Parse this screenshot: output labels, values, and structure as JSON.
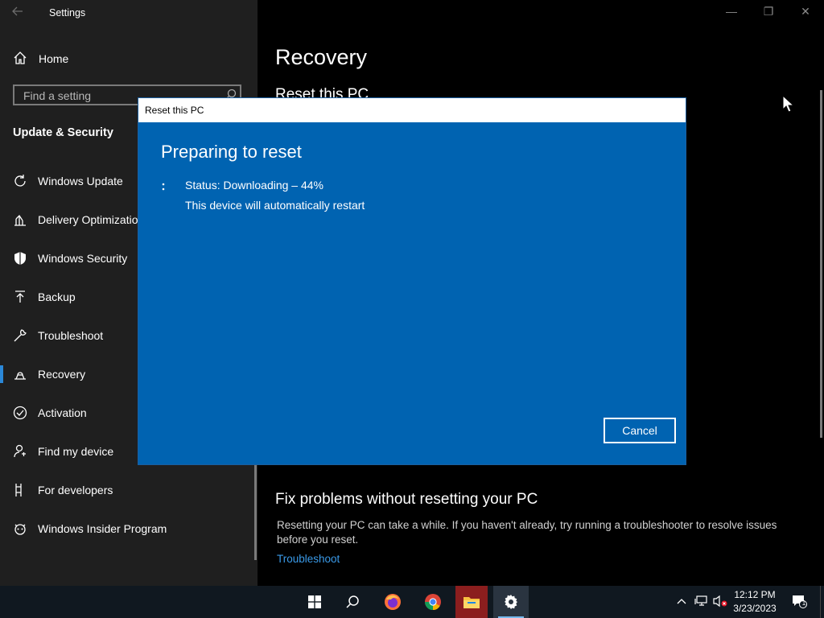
{
  "window": {
    "app_title": "Settings",
    "controls": {
      "minimize": "—",
      "restore": "❐",
      "close": "✕"
    }
  },
  "sidebar": {
    "home_label": "Home",
    "search_placeholder": "Find a setting",
    "section_title": "Update & Security",
    "items": [
      {
        "label": "Windows Update",
        "icon": "refresh-icon"
      },
      {
        "label": "Delivery Optimization",
        "icon": "delivery-icon"
      },
      {
        "label": "Windows Security",
        "icon": "shield-icon"
      },
      {
        "label": "Backup",
        "icon": "upload-icon"
      },
      {
        "label": "Troubleshoot",
        "icon": "wrench-icon"
      },
      {
        "label": "Recovery",
        "icon": "recovery-icon",
        "active": true
      },
      {
        "label": "Activation",
        "icon": "check-circle-icon"
      },
      {
        "label": "Find my device",
        "icon": "person-pin-icon"
      },
      {
        "label": "For developers",
        "icon": "developer-icon"
      },
      {
        "label": "Windows Insider Program",
        "icon": "insider-icon"
      }
    ]
  },
  "main": {
    "page_title": "Recovery",
    "reset_section_title": "Reset this PC",
    "fix_title": "Fix problems without resetting your PC",
    "fix_description": "Resetting your PC can take a while. If you haven't already, try running a troubleshooter to resolve issues before you reset.",
    "fix_link": "Troubleshoot"
  },
  "dialog": {
    "title": "Reset this PC",
    "heading": "Preparing to reset",
    "status": "Status: Downloading – 44%",
    "progress_percent": 44,
    "note": "This device will automatically restart",
    "cancel_label": "Cancel"
  },
  "taskbar": {
    "apps": [
      "start-icon",
      "search-icon",
      "firefox-icon",
      "chrome-icon",
      "file-explorer-icon",
      "settings-icon"
    ],
    "clock_time": "12:12 PM",
    "clock_date": "3/23/2023",
    "notification_count": "1"
  },
  "colors": {
    "dialog_blue": "#0063b1",
    "accent": "#2b88d8",
    "link": "#3a9ae8",
    "sidebar_bg": "#1f1f1f"
  }
}
